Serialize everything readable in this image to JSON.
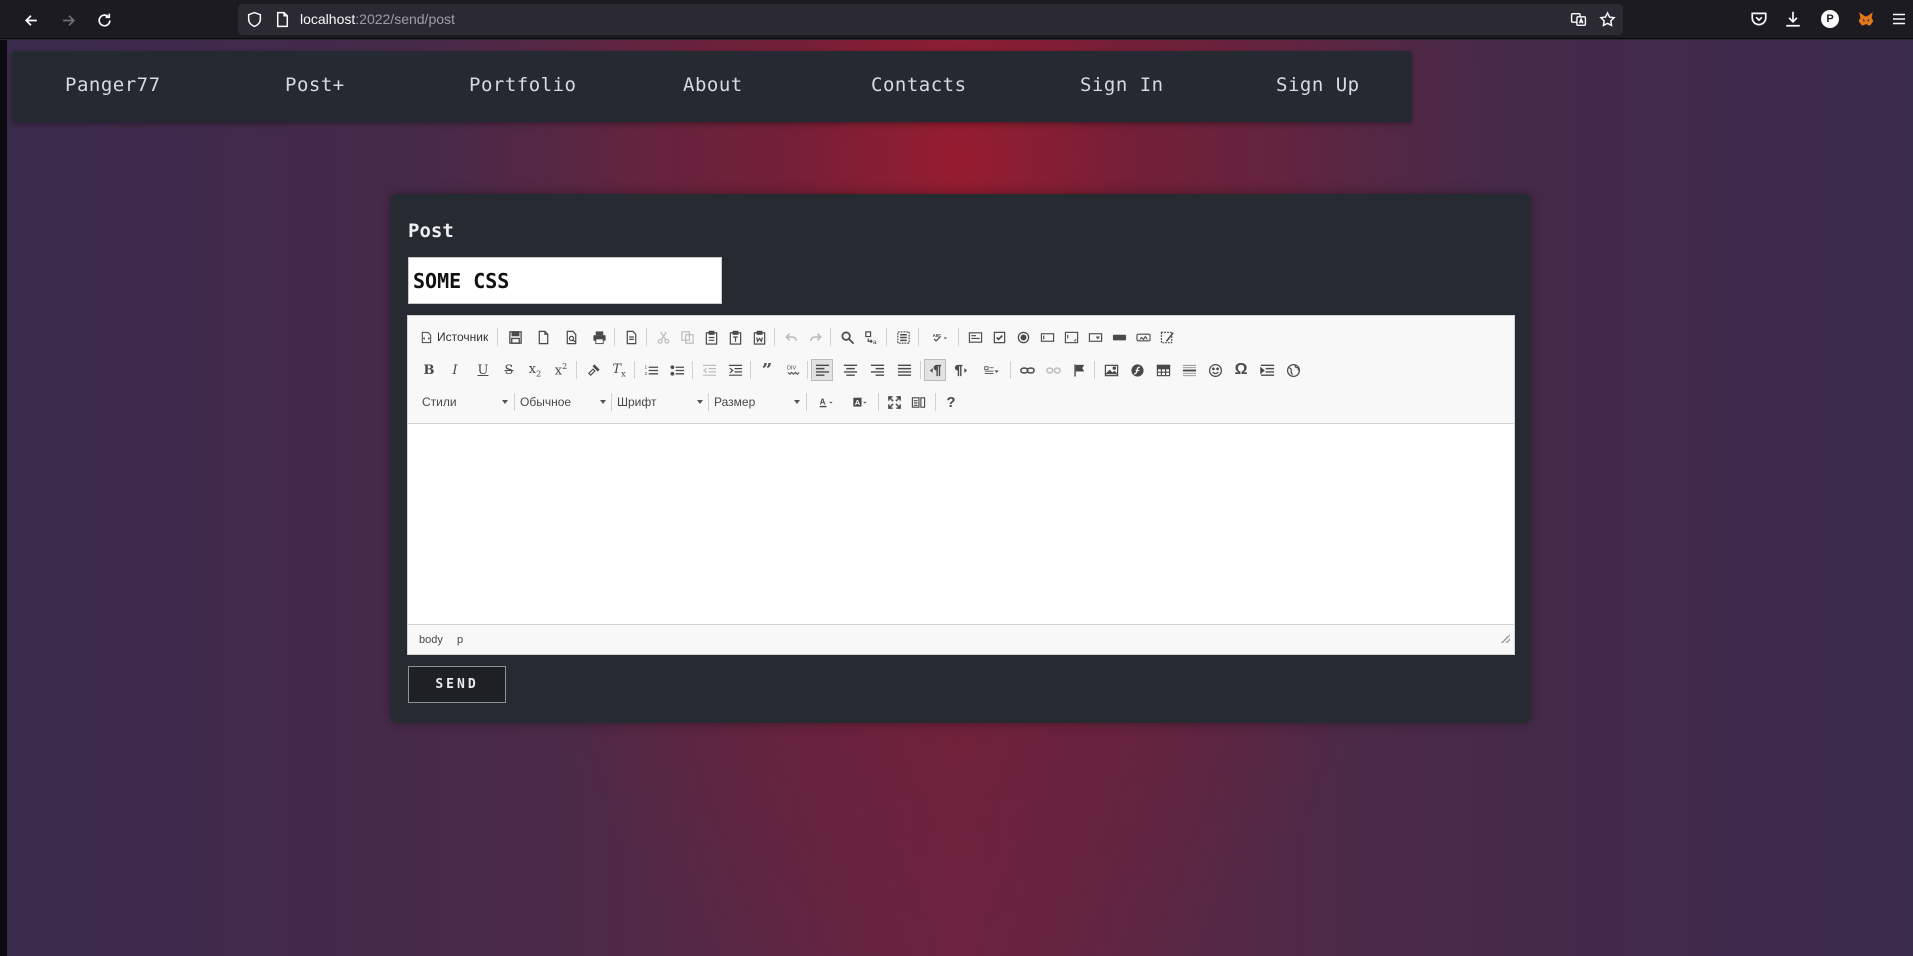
{
  "browser": {
    "url_host": "localhost",
    "url_path": ":2022/send/post",
    "profile_initial": "P"
  },
  "nav": {
    "items": [
      "Panger77",
      "Post+",
      "Portfolio",
      "About",
      "Contacts",
      "Sign In",
      "Sign Up"
    ]
  },
  "post": {
    "heading": "Post",
    "title_value": "SOME CSS",
    "send_label": "SEND"
  },
  "editor": {
    "source_label": "Источник",
    "combos": {
      "styles": "Стили",
      "format": "Обычное",
      "font": "Шрифт",
      "size": "Размер"
    },
    "path": [
      "body",
      "p"
    ]
  },
  "colors": {
    "accent_red": "#981c30",
    "panel": "#262b32",
    "nav_bg": "#252a32"
  }
}
